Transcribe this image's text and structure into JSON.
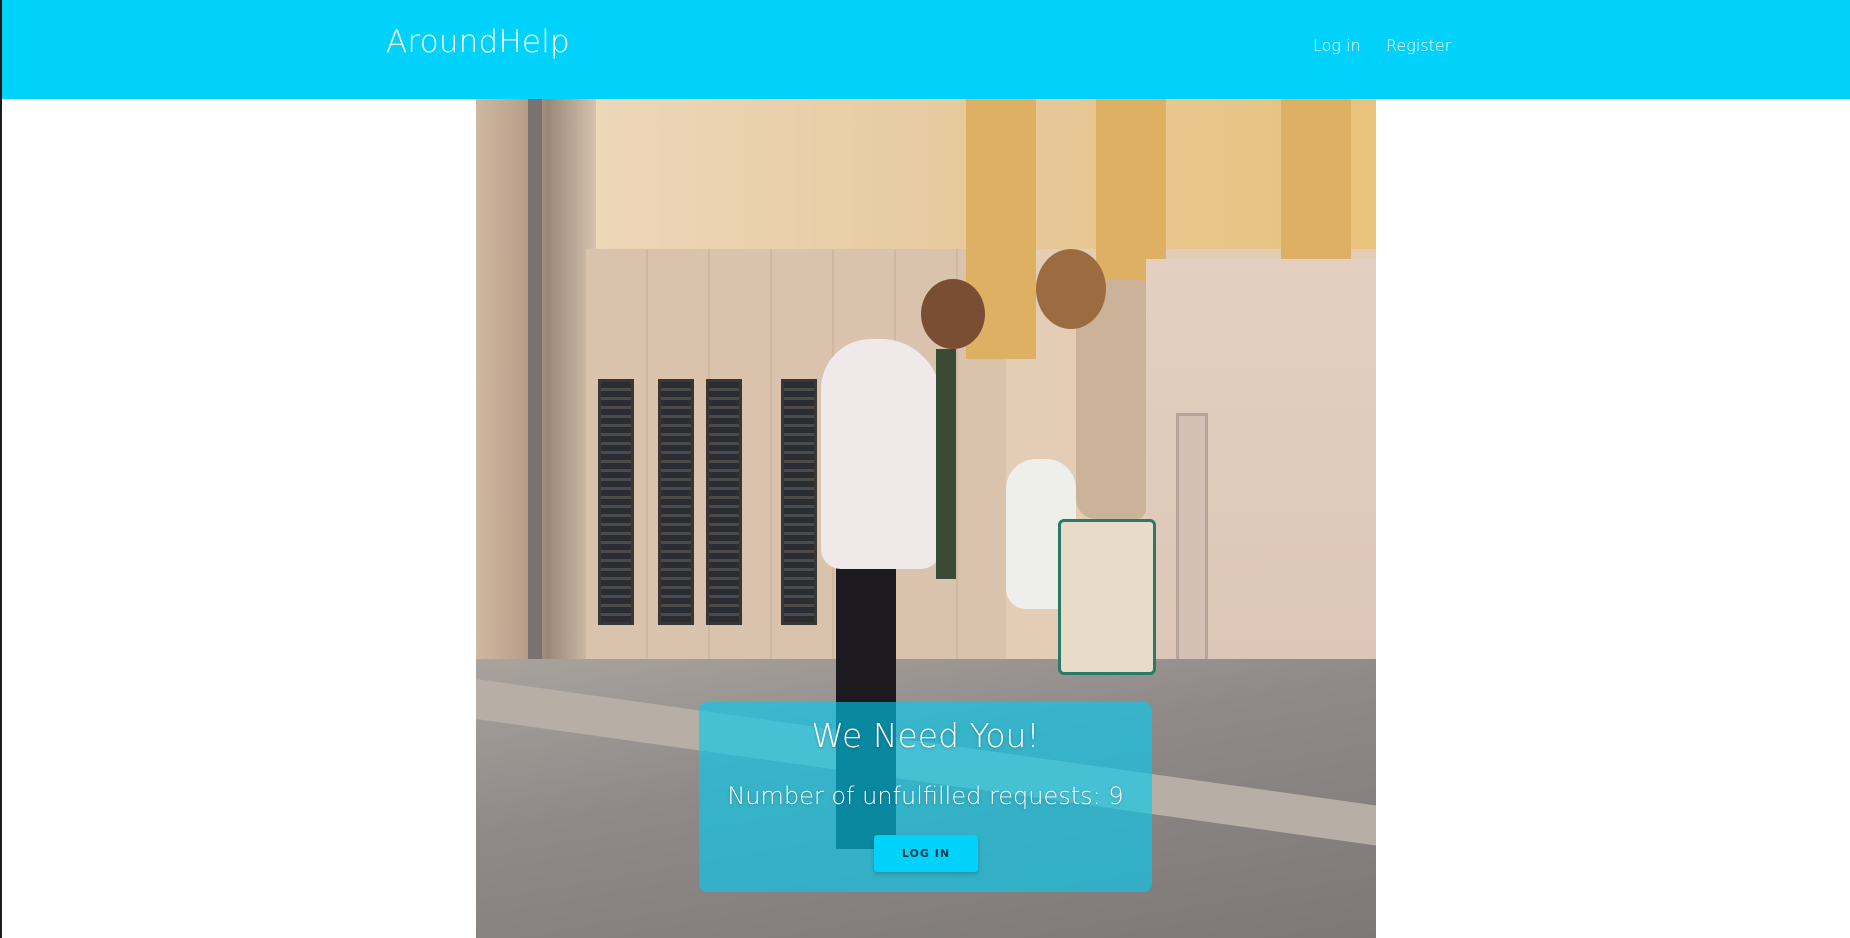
{
  "navbar": {
    "brand": "AroundHelp",
    "links": [
      {
        "label": "Log in"
      },
      {
        "label": "Register"
      }
    ],
    "color": "#00d2fc"
  },
  "hero": {
    "image": "two women exchanging shopping bags at a doorway on a stone street"
  },
  "cta": {
    "title": "We Need You!",
    "unfulfilled_label": "Number of unfulfilled requests: 9",
    "button_label": "LOG IN"
  }
}
